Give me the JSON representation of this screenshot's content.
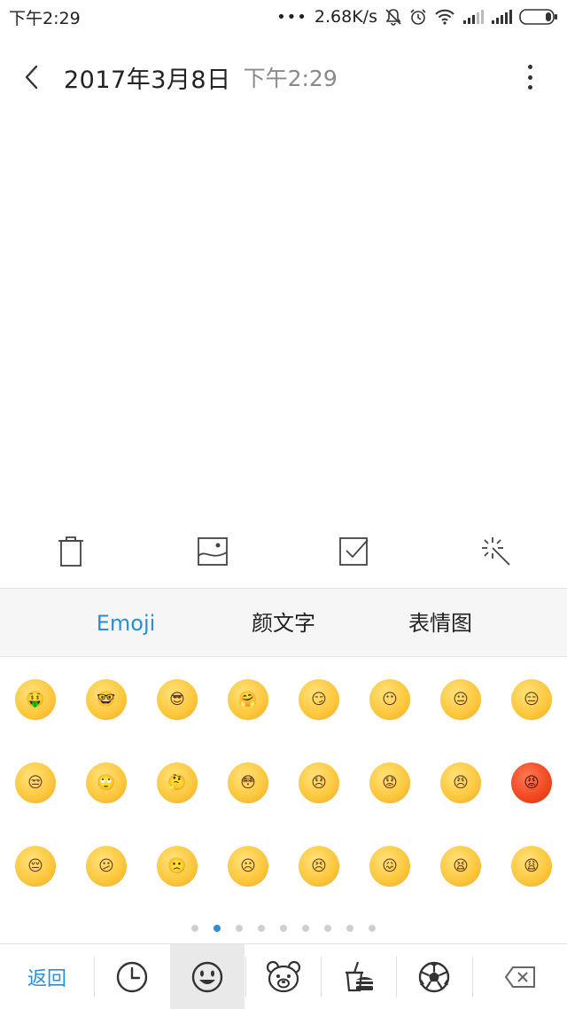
{
  "status_bar": {
    "time": "下午2:29",
    "network_speed": "2.68K/s"
  },
  "header": {
    "date": "2017年3月8日",
    "time": "下午2:29"
  },
  "toolbar": {
    "icons": [
      "trash-icon",
      "image-icon",
      "checkbox-icon",
      "magic-wand-icon"
    ]
  },
  "emoji_panel": {
    "tabs": [
      {
        "label": "Emoji",
        "active": true
      },
      {
        "label": "颜文字",
        "active": false
      },
      {
        "label": "表情图",
        "active": false
      }
    ],
    "emojis": [
      [
        "🤑",
        "🤓",
        "😎",
        "🤗",
        "😏",
        "😶",
        "😐",
        "😑"
      ],
      [
        "😒",
        "🙄",
        "🤔",
        "😳",
        "😞",
        "😟",
        "😠",
        "😡"
      ],
      [
        "😔",
        "😕",
        "🙁",
        "☹",
        "😣",
        "😖",
        "😫",
        "😩"
      ]
    ],
    "page_count": 9,
    "active_page": 2
  },
  "bottom_bar": {
    "return_label": "返回",
    "categories": [
      "clock-icon",
      "smiley-icon",
      "bear-icon",
      "food-icon",
      "soccer-ball-icon"
    ],
    "selected_category": "smiley-icon"
  },
  "colors": {
    "accent": "#2a8fd6",
    "emoji_yellow": "#fcc63b",
    "emoji_red": "#f0471f"
  }
}
